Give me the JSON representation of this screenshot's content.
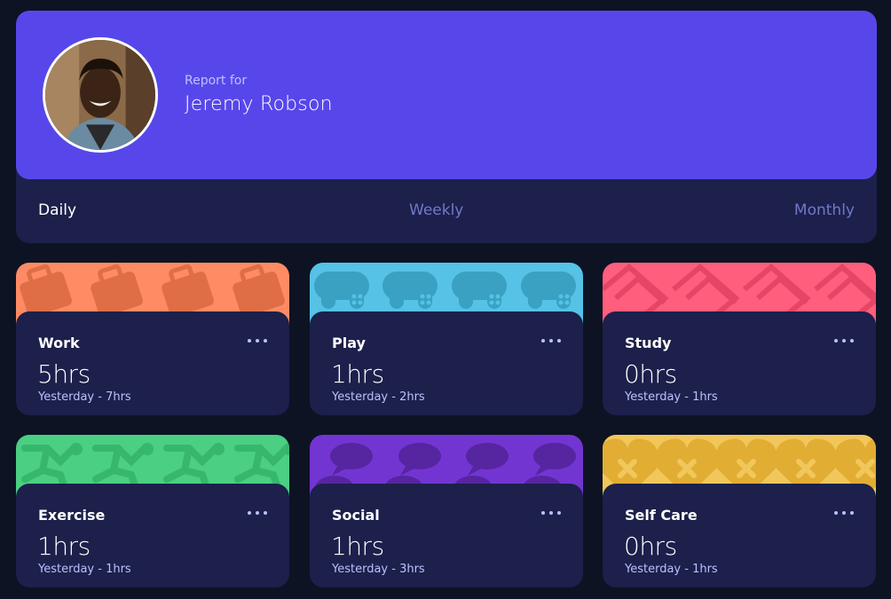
{
  "profile": {
    "report_label": "Report for",
    "name": "Jeremy Robson",
    "avatar_icon": "user-photo"
  },
  "tabs": [
    {
      "label": "Daily",
      "active": true
    },
    {
      "label": "Weekly",
      "active": false
    },
    {
      "label": "Monthly",
      "active": false
    }
  ],
  "colors": {
    "background": "#0d1323",
    "card": "#1c204b",
    "profile_accent": "#5747ea",
    "tab_inactive": "#7078c9",
    "subtext": "#bbc0ff"
  },
  "activities": [
    {
      "title": "Work",
      "current": "5hrs",
      "previous": "Yesterday - 7hrs",
      "color": "#ff8b64",
      "icon": "briefcase-icon"
    },
    {
      "title": "Play",
      "current": "1hrs",
      "previous": "Yesterday - 2hrs",
      "color": "#55c2e6",
      "icon": "gamepad-icon"
    },
    {
      "title": "Study",
      "current": "0hrs",
      "previous": "Yesterday - 1hrs",
      "color": "#ff5e7d",
      "icon": "book-icon"
    },
    {
      "title": "Exercise",
      "current": "1hrs",
      "previous": "Yesterday - 1hrs",
      "color": "#4bcf82",
      "icon": "runner-icon"
    },
    {
      "title": "Social",
      "current": "1hrs",
      "previous": "Yesterday - 3hrs",
      "color": "#7335d2",
      "icon": "chat-bubble-icon"
    },
    {
      "title": "Self Care",
      "current": "0hrs",
      "previous": "Yesterday - 1hrs",
      "color": "#f1c75b",
      "icon": "heart-plus-icon"
    }
  ]
}
